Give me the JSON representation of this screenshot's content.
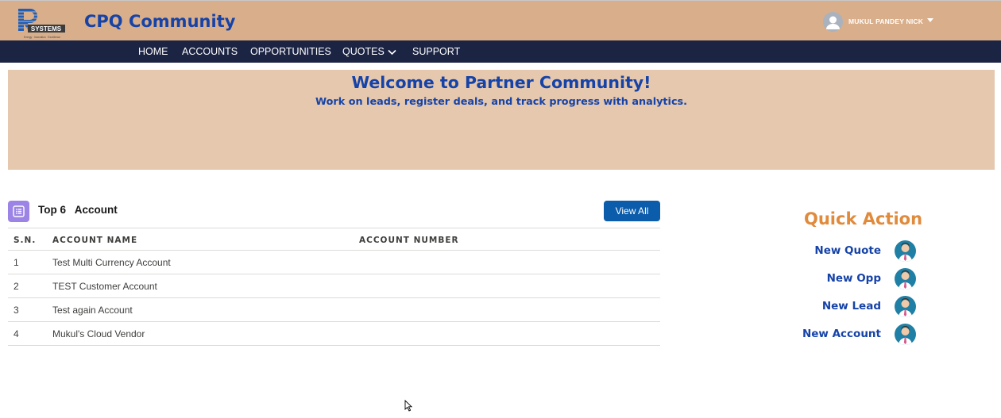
{
  "header": {
    "logo_text": "SYSTEMS",
    "logo_letter": "R",
    "logo_tagline": "Energy · Innovation · Excellence",
    "site_title": "CPQ Community",
    "user_name": "MUKUL PANDEY NICK"
  },
  "nav": {
    "items": [
      "HOME",
      "ACCOUNTS",
      "OPPORTUNITIES",
      "QUOTES",
      "SUPPORT"
    ]
  },
  "banner": {
    "title": "Welcome to Partner Community!",
    "subtitle": "Work on leads, register deals, and track progress with analytics."
  },
  "accounts_card": {
    "title": "Top 6   Account",
    "view_all_label": "View All",
    "columns": [
      "S.N.",
      "ACCOUNT NAME",
      "ACCOUNT NUMBER"
    ],
    "rows": [
      {
        "sn": "1",
        "name": "Test Multi Currency Account",
        "number": ""
      },
      {
        "sn": "2",
        "name": "TEST Customer Account",
        "number": ""
      },
      {
        "sn": "3",
        "name": "Test again Account",
        "number": ""
      },
      {
        "sn": "4",
        "name": "Mukul's Cloud Vendor",
        "number": ""
      }
    ]
  },
  "quick_action": {
    "title": "Quick Action",
    "items": [
      {
        "label": "New Quote",
        "icon": "person-avatar-icon"
      },
      {
        "label": "New Opp",
        "icon": "person-avatar-icon"
      },
      {
        "label": "New Lead",
        "icon": "person-avatar-icon"
      },
      {
        "label": "New Account",
        "icon": "person-avatar-icon"
      }
    ]
  },
  "colors": {
    "header_bg": "#d9ae8a",
    "nav_bg": "#1c2444",
    "banner_bg": "#e5c8ae",
    "brand_blue": "#1643a8",
    "accent_orange": "#e08a3c",
    "button_blue": "#0b5cab"
  }
}
